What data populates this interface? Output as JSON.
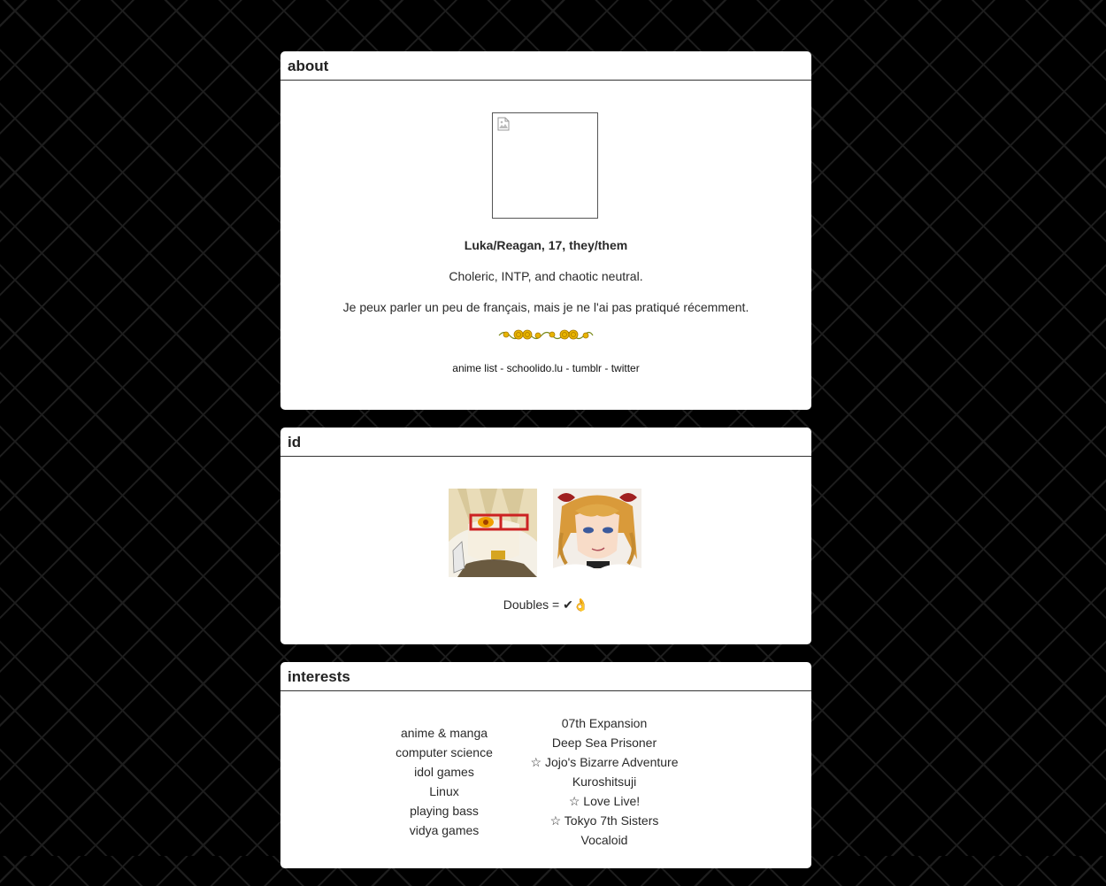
{
  "about": {
    "title": "about",
    "name_line": "Luka/Reagan, 17, they/them",
    "temperament": "Choleric, INTP, and chaotic neutral.",
    "french": "Je peux parler un peu de français, mais je ne l'ai pas pratiqué récemment.",
    "links": [
      {
        "label": "anime list"
      },
      {
        "label": "schoolido.lu"
      },
      {
        "label": "tumblr"
      },
      {
        "label": "twitter"
      }
    ],
    "link_separator": " - "
  },
  "id_panel": {
    "title": "id",
    "doubles_text": "Doubles = ✔👌"
  },
  "interests": {
    "title": "interests",
    "general": [
      "anime & manga",
      "computer science",
      "idol games",
      "Linux",
      "playing bass",
      "vidya games"
    ],
    "fandoms": [
      "07th Expansion",
      "Deep Sea Prisoner",
      "☆ Jojo's Bizarre Adventure",
      "Kuroshitsuji",
      "☆ Love Live!",
      "☆ Tokyo 7th Sisters",
      "Vocaloid"
    ]
  },
  "colors": {
    "background": "#000000",
    "panel": "#ffffff",
    "text": "#2a2a2a",
    "flower": "#e8b400"
  },
  "icons": {
    "broken_image": "broken-image-icon",
    "flower_divider": "flower-divider-icon"
  }
}
